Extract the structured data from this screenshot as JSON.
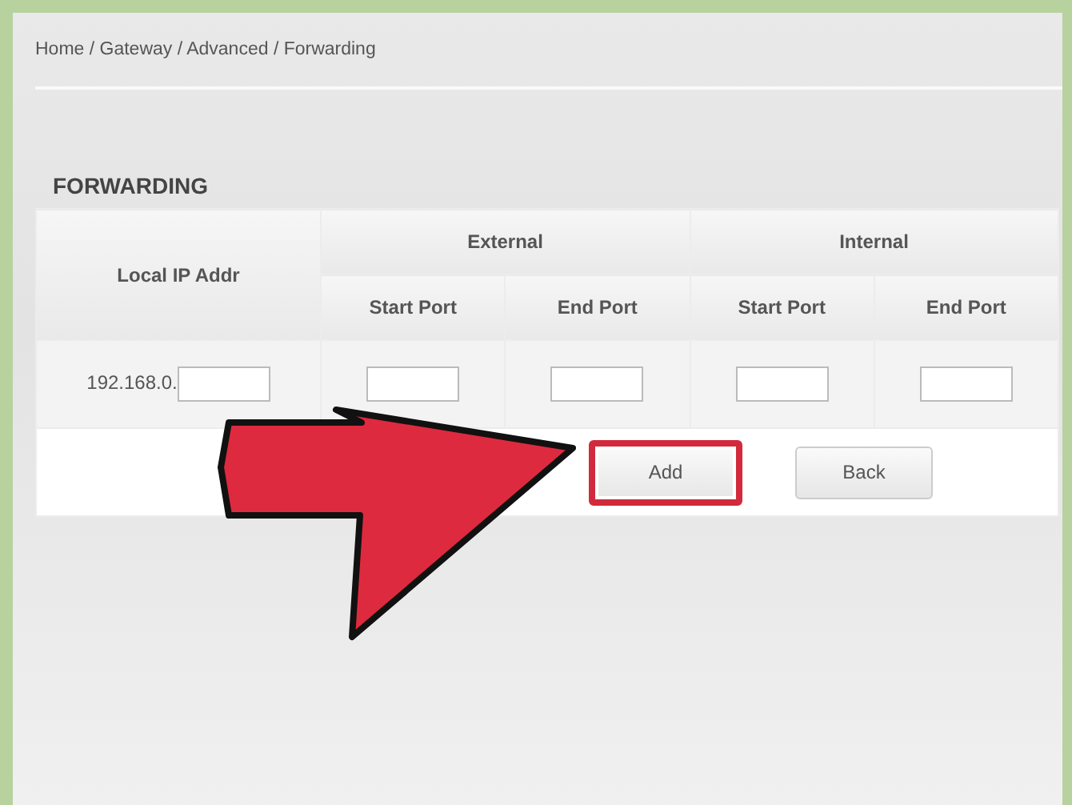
{
  "breadcrumb": "Home / Gateway / Advanced / Forwarding",
  "section_title": "FORWARDING",
  "table": {
    "local_column": "Local IP Addr",
    "groups": [
      {
        "label": "External",
        "columns": [
          "Start Port",
          "End Port"
        ]
      },
      {
        "label": "Internal",
        "columns": [
          "Start Port",
          "End Port"
        ]
      }
    ],
    "row": {
      "ip_prefix": "192.168.0."
    }
  },
  "buttons": [
    {
      "label": "Add",
      "highlighted": true
    },
    {
      "label": "Back",
      "highlighted": false
    }
  ]
}
